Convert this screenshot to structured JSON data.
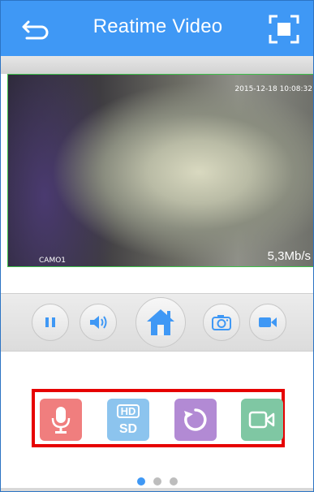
{
  "header": {
    "title": "Reatime Video"
  },
  "video": {
    "timestamp": "2015-12-18 10:08:32",
    "camera_name": "CAMO1",
    "bitrate": "5,3Mb/s"
  },
  "controls": [
    {
      "name": "pause",
      "icon": "pause-icon"
    },
    {
      "name": "volume",
      "icon": "speaker-icon"
    },
    {
      "name": "home",
      "icon": "home-icon"
    },
    {
      "name": "snapshot",
      "icon": "camera-icon"
    },
    {
      "name": "record",
      "icon": "video-camera-icon"
    }
  ],
  "actions": [
    {
      "name": "talk",
      "icon": "microphone-icon",
      "color": "#f07e7e"
    },
    {
      "name": "quality",
      "icon": "hd-sd-icon",
      "color": "#8cc4ee",
      "label_top": "HD",
      "label_bottom": "SD"
    },
    {
      "name": "rotate",
      "icon": "rotate-icon",
      "color": "#b28ad4"
    },
    {
      "name": "record-video",
      "icon": "video-camera-icon",
      "color": "#7fc7a3"
    }
  ],
  "pager": {
    "pages": 3,
    "active": 0
  },
  "colors": {
    "header": "#3f98f5",
    "highlight": "#e60000"
  }
}
